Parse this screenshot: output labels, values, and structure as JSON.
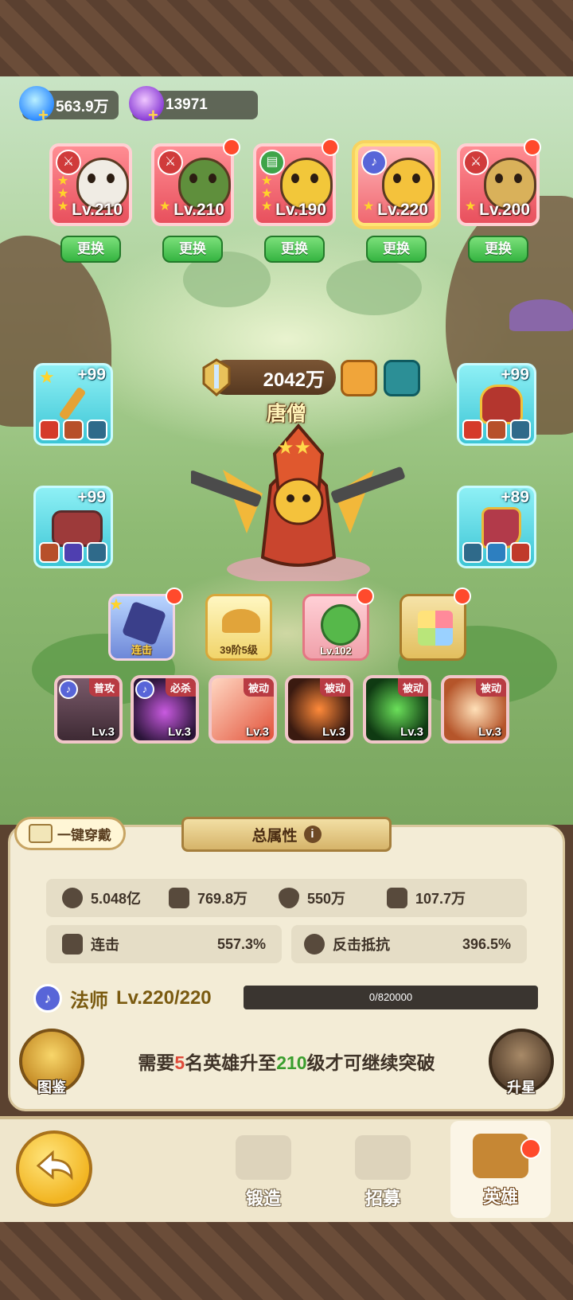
{
  "currency": {
    "energy": "563.9万",
    "gems": "13971"
  },
  "team": [
    {
      "level": "Lv.210",
      "class": "warrior",
      "stars": 3,
      "button": "更换",
      "has_dot": false,
      "selected": false
    },
    {
      "level": "Lv.210",
      "class": "warrior",
      "stars": 1,
      "button": "更换",
      "has_dot": true,
      "selected": false
    },
    {
      "level": "Lv.190",
      "class": "support",
      "stars": 3,
      "button": "更换",
      "has_dot": true,
      "selected": false
    },
    {
      "level": "Lv.220",
      "class": "mage",
      "stars": 1,
      "button": "更换",
      "has_dot": false,
      "selected": true
    },
    {
      "level": "Lv.200",
      "class": "warrior",
      "stars": 1,
      "button": "更换",
      "has_dot": true,
      "selected": false
    }
  ],
  "hero": {
    "power": "2042万",
    "name": "唐僧"
  },
  "equipment": {
    "weapon": "+99",
    "helmet": "+99",
    "armor": "+99",
    "boots": "+89"
  },
  "extras": {
    "combo_label": "连击",
    "wings_label": "39阶5级",
    "pet_level": "Lv.102"
  },
  "skills": [
    {
      "tag": "普攻",
      "level": "Lv.3",
      "has_class": true
    },
    {
      "tag": "必杀",
      "level": "Lv.3",
      "has_class": true
    },
    {
      "tag": "被动",
      "level": "Lv.3",
      "has_class": false
    },
    {
      "tag": "被动",
      "level": "Lv.3",
      "has_class": false
    },
    {
      "tag": "被动",
      "level": "Lv.3",
      "has_class": false
    },
    {
      "tag": "被动",
      "level": "Lv.3",
      "has_class": false
    }
  ],
  "panel": {
    "equip_all": "一键穿戴",
    "title": "总属性",
    "stats": {
      "hp": "5.048亿",
      "attack": "769.8万",
      "defense": "550万",
      "speed": "107.7万",
      "combo_label": "连击",
      "combo_value": "557.3%",
      "counter_resist_label": "反击抵抗",
      "counter_resist_value": "396.5%"
    },
    "class_name": "法师",
    "class_level": "Lv.220/220",
    "xp": "0/820000",
    "need_pre": "需要",
    "need_count": "5",
    "need_mid": "名英雄升至",
    "need_level": "210",
    "need_post": "级才可继续突破",
    "codex": "图鉴",
    "star_up": "升星"
  },
  "nav": {
    "forge": "锻造",
    "recruit": "招募",
    "heroes": "英雄"
  }
}
